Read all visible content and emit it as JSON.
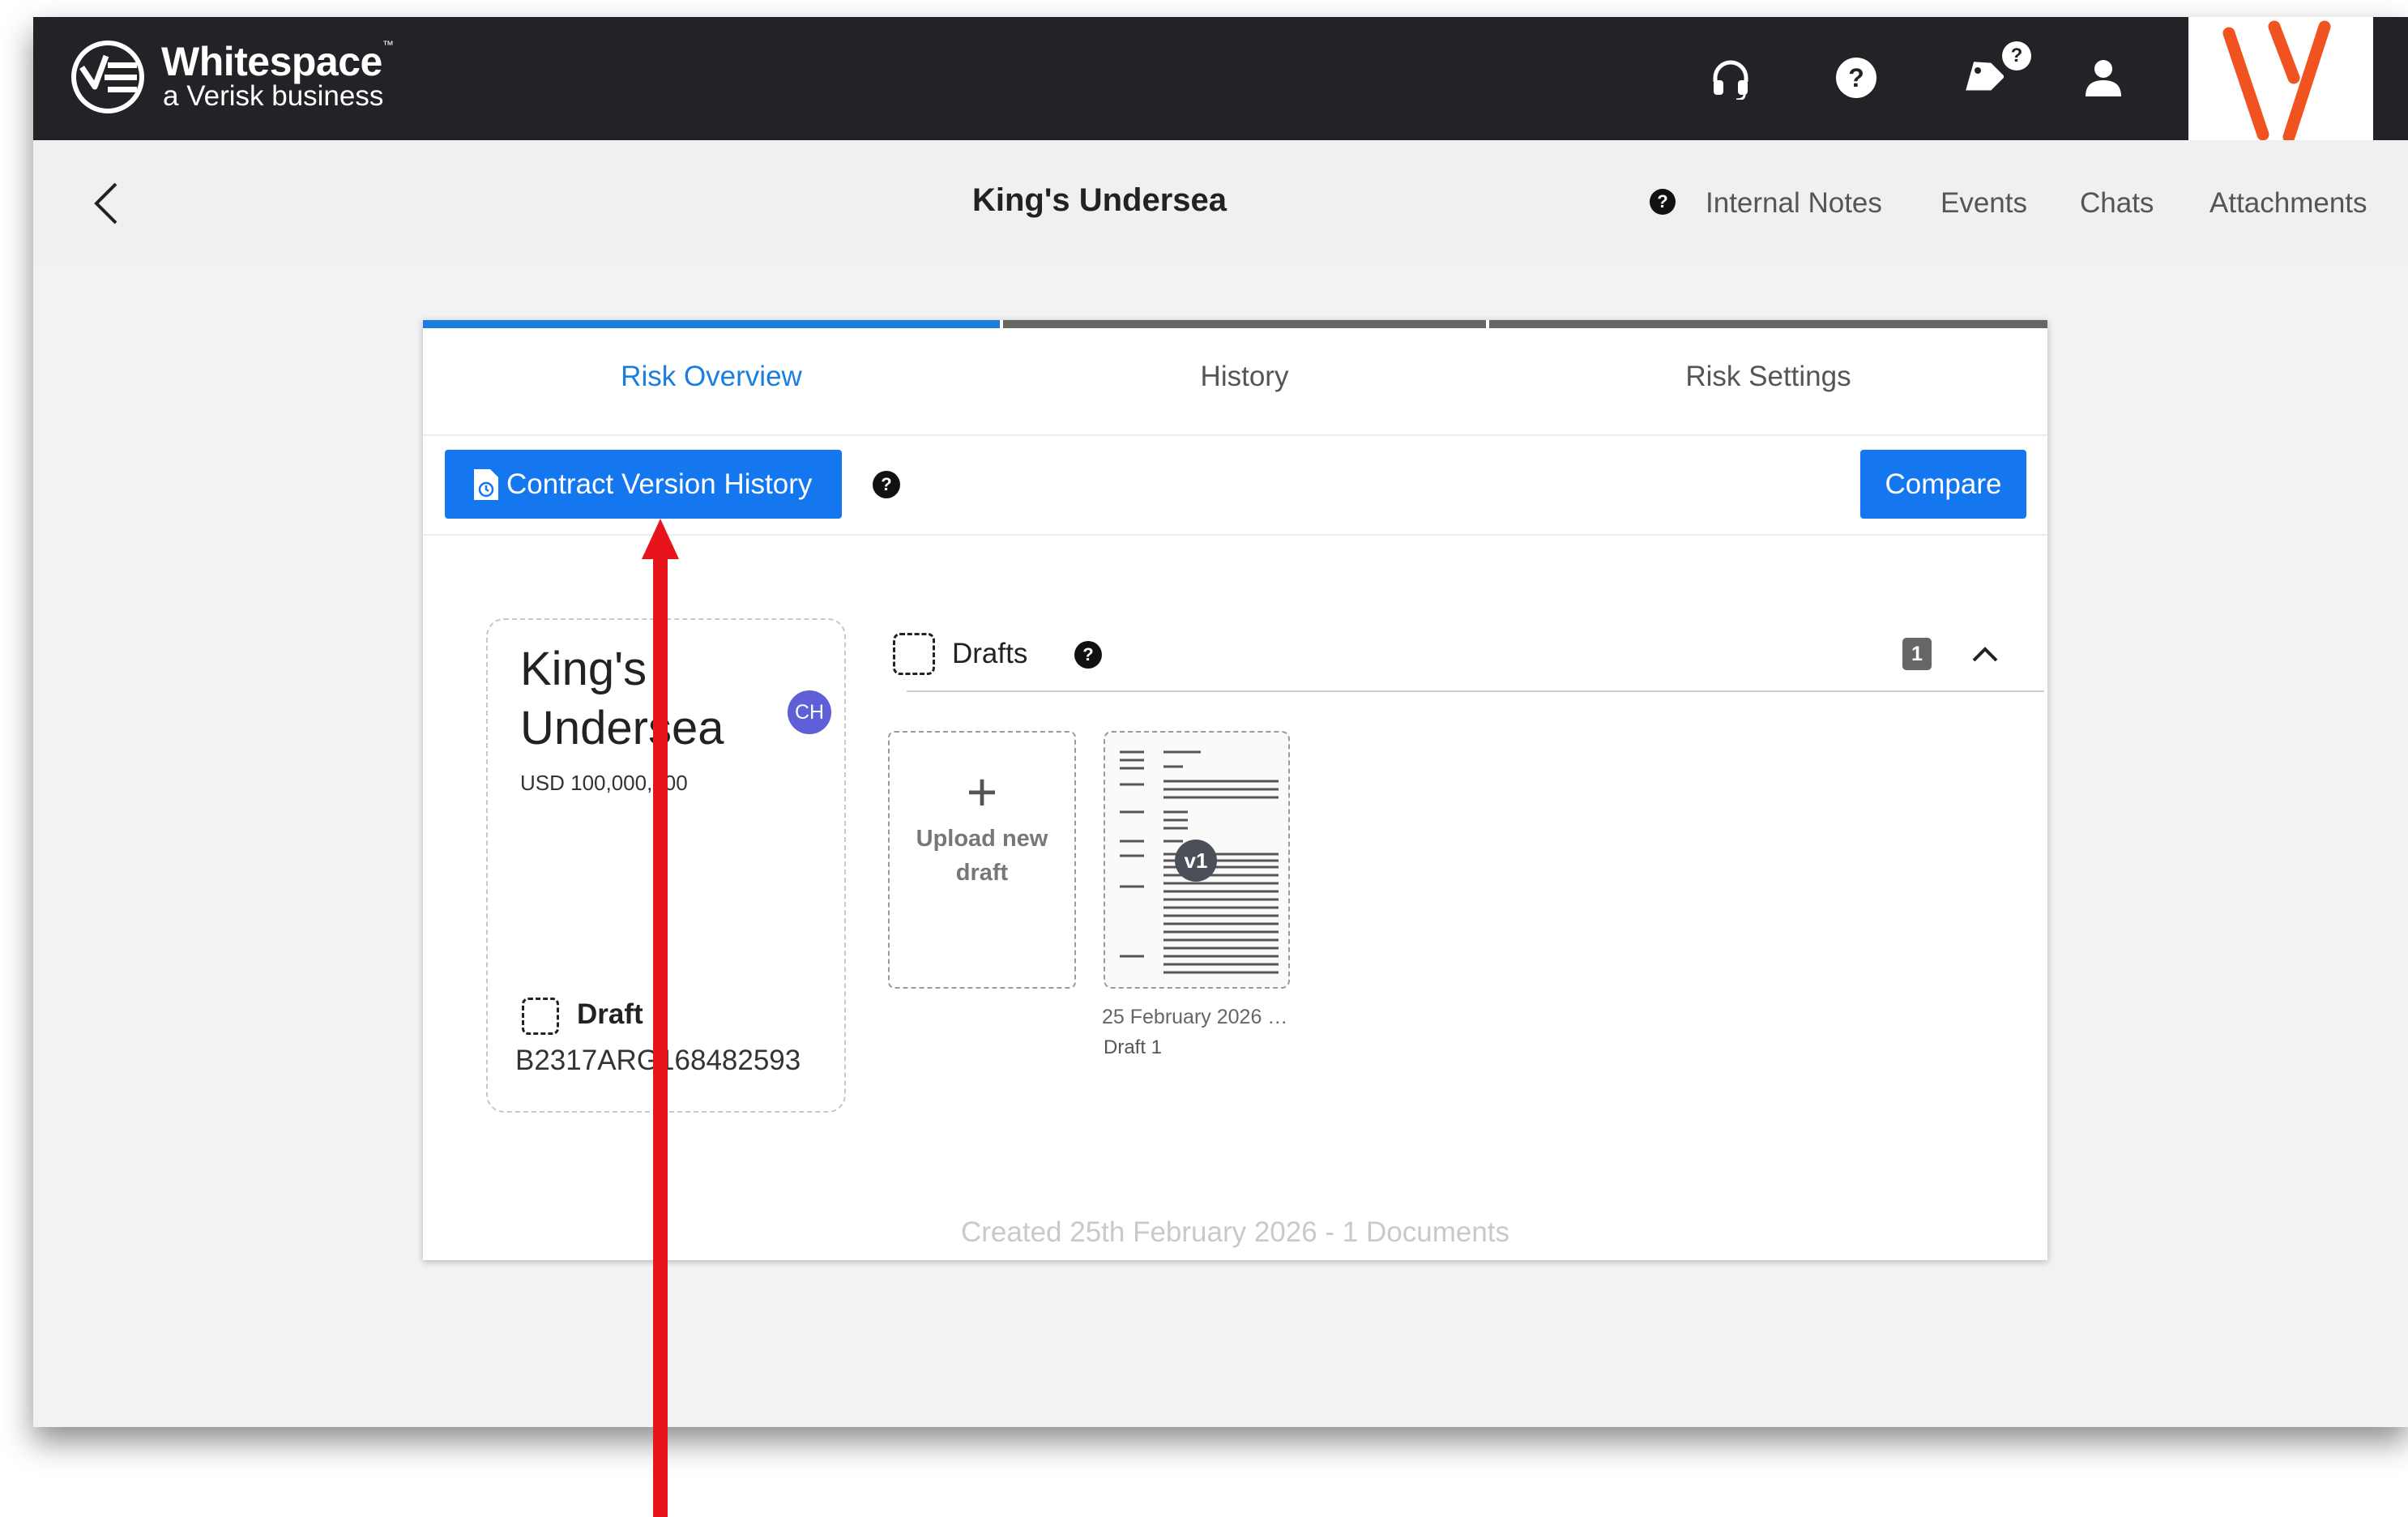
{
  "topbar": {
    "brand": "Whitespace",
    "brand_tm": "™",
    "tagline": "a Verisk business",
    "icons": [
      "headset-icon",
      "help-icon",
      "tag-icon",
      "user-icon"
    ],
    "tag_badge": "?"
  },
  "subheader": {
    "title": "King's Undersea",
    "help_badge": "?",
    "links": [
      "Internal Notes",
      "Events",
      "Chats",
      "Attachments"
    ]
  },
  "tabs": [
    {
      "label": "Risk Overview",
      "active": true
    },
    {
      "label": "History",
      "active": false
    },
    {
      "label": "Risk Settings",
      "active": false
    }
  ],
  "toolbar": {
    "contract_button": "Contract Version History",
    "help_badge": "?",
    "compare_button": "Compare"
  },
  "risk_card": {
    "title_line1": "King's",
    "title_line2": "Undersea",
    "avatar": "CH",
    "amount": "USD 100,000,000",
    "status": "Draft",
    "reference": "B2317ARG168482593"
  },
  "drafts": {
    "label": "Drafts",
    "help_badge": "?",
    "count": "1",
    "upload_line1": "Upload new",
    "upload_line2": "draft",
    "document": {
      "version": "v1",
      "date": "25 February 2026 …",
      "name": "Draft 1"
    }
  },
  "footer": "Created 25th February 2026 - 1 Documents",
  "colors": {
    "primary": "#1577f0",
    "active_tab": "#1a7de0",
    "topbar": "#222326",
    "annotation": "#e8141c",
    "avatar": "#5f5fd8",
    "logo_orange": "#f0531f"
  }
}
